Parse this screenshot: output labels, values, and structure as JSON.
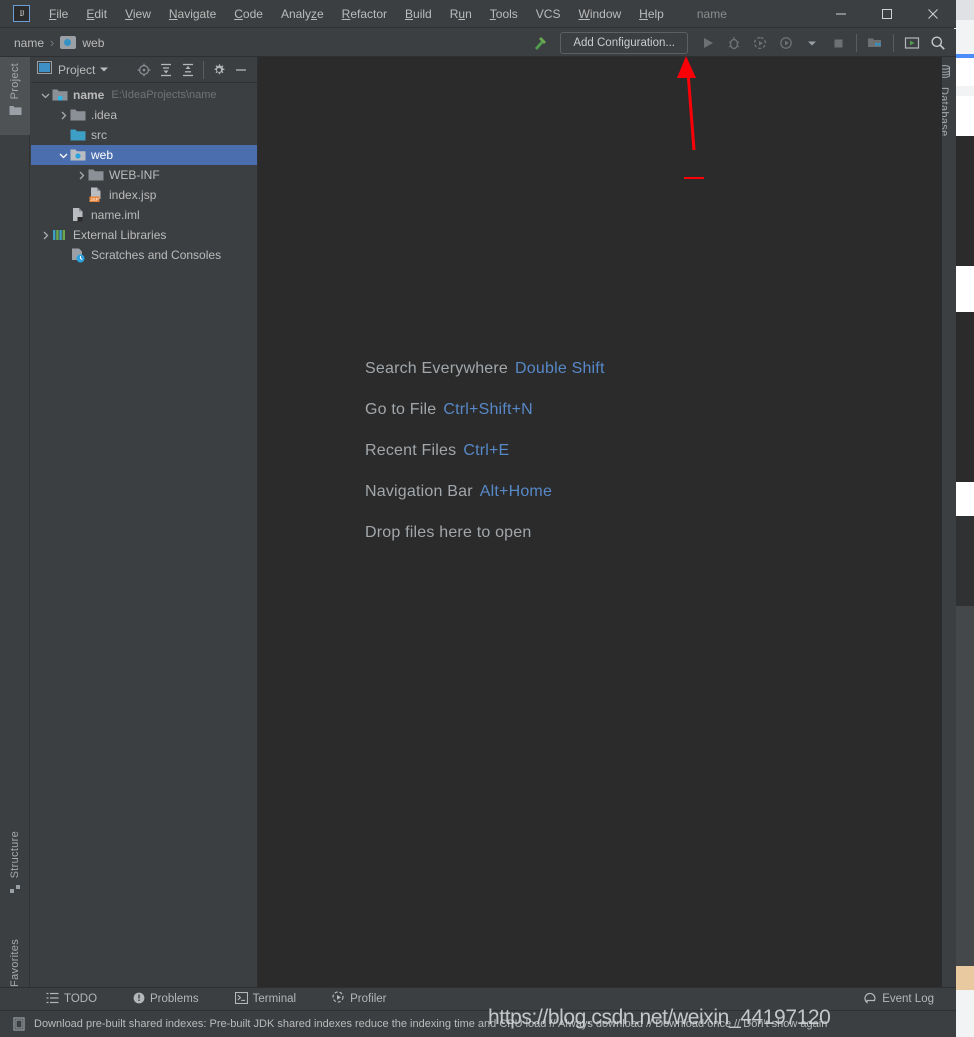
{
  "window": {
    "title": "name",
    "logo_text": "IJ",
    "controls": [
      {
        "name": "minimize",
        "glyph": "minimize-icon"
      },
      {
        "name": "maximize",
        "glyph": "maximize-icon"
      },
      {
        "name": "close",
        "glyph": "close-icon"
      }
    ]
  },
  "menubar": {
    "items": [
      {
        "label": "File",
        "mnemonic": "F"
      },
      {
        "label": "Edit",
        "mnemonic": "E"
      },
      {
        "label": "View",
        "mnemonic": "V"
      },
      {
        "label": "Navigate",
        "mnemonic": "N"
      },
      {
        "label": "Code",
        "mnemonic": "C"
      },
      {
        "label": "Analyze",
        "mnemonic": "y"
      },
      {
        "label": "Refactor",
        "mnemonic": "R"
      },
      {
        "label": "Build",
        "mnemonic": "B"
      },
      {
        "label": "Run",
        "mnemonic": "u"
      },
      {
        "label": "Tools",
        "mnemonic": "T"
      },
      {
        "label": "VCS",
        "mnemonic": ""
      },
      {
        "label": "Window",
        "mnemonic": "W"
      },
      {
        "label": "Help",
        "mnemonic": "H"
      }
    ]
  },
  "navbar": {
    "breadcrumbs": [
      "name",
      "web"
    ],
    "separator": "›",
    "run_config_button": "Add Configuration...",
    "icons": [
      "build-hammer-icon",
      "run-icon",
      "debug-icon",
      "run-with-coverage-icon",
      "profile-icon",
      "dropdown-arrow-icon",
      "stop-icon",
      "project-structure-icon",
      "update-icon",
      "search-icon"
    ]
  },
  "left_toolwindow_strip": {
    "top": [
      {
        "label": "Project",
        "icon": "folder-icon",
        "active": true
      }
    ],
    "bottom": [
      {
        "label": "Structure",
        "icon": "structure-icon",
        "active": false
      },
      {
        "label": "Favorites",
        "icon": "star-icon",
        "active": false
      }
    ]
  },
  "right_toolwindow_strip": {
    "items": [
      {
        "label": "Database",
        "icon": "database-icon",
        "active": false
      }
    ]
  },
  "project_panel": {
    "title": "Project",
    "header_icons": [
      "chevron-down-icon",
      "select-opened-file-icon",
      "expand-all-icon",
      "collapse-all-icon",
      "gear-icon",
      "hide-icon"
    ],
    "tree": [
      {
        "label": "name",
        "path": "E:\\IdeaProjects\\name",
        "icon": "module-folder-icon",
        "indent": 0,
        "arrow": "down",
        "selected": false,
        "bold": true
      },
      {
        "label": ".idea",
        "path": "",
        "icon": "folder-icon",
        "indent": 1,
        "arrow": "right",
        "selected": false,
        "bold": false
      },
      {
        "label": "src",
        "path": "",
        "icon": "source-folder-icon",
        "indent": 1,
        "arrow": "none",
        "selected": false,
        "bold": false
      },
      {
        "label": "web",
        "path": "",
        "icon": "web-folder-icon",
        "indent": 1,
        "arrow": "down",
        "selected": true,
        "bold": false
      },
      {
        "label": "WEB-INF",
        "path": "",
        "icon": "folder-icon",
        "indent": 2,
        "arrow": "right",
        "selected": false,
        "bold": false
      },
      {
        "label": "index.jsp",
        "path": "",
        "icon": "jsp-file-icon",
        "indent": 2,
        "arrow": "none",
        "selected": false,
        "bold": false
      },
      {
        "label": "name.iml",
        "path": "",
        "icon": "iml-file-icon",
        "indent": 1,
        "arrow": "none",
        "selected": false,
        "bold": false
      },
      {
        "label": "External Libraries",
        "path": "",
        "icon": "libraries-icon",
        "indent": 0,
        "arrow": "right",
        "selected": false,
        "bold": false
      },
      {
        "label": "Scratches and Consoles",
        "path": "",
        "icon": "scratches-icon",
        "indent": 0,
        "arrow": "none",
        "selected": false,
        "bold": false
      }
    ]
  },
  "editor": {
    "hints": [
      {
        "action": "Search Everywhere",
        "shortcut": "Double Shift"
      },
      {
        "action": "Go to File",
        "shortcut": "Ctrl+Shift+N"
      },
      {
        "action": "Recent Files",
        "shortcut": "Ctrl+E"
      },
      {
        "action": "Navigation Bar",
        "shortcut": "Alt+Home"
      },
      {
        "action": "Drop files here to open",
        "shortcut": ""
      }
    ]
  },
  "bottom_toolwindows": {
    "left": [
      {
        "label": "TODO",
        "icon": "todo-list-icon"
      },
      {
        "label": "Problems",
        "icon": "problems-icon"
      },
      {
        "label": "Terminal",
        "icon": "terminal-icon"
      },
      {
        "label": "Profiler",
        "icon": "profiler-icon"
      }
    ],
    "right": [
      {
        "label": "Event Log",
        "icon": "event-log-icon"
      }
    ]
  },
  "statusbar": {
    "icon": "notification-icon",
    "message": "Download pre-built shared indexes: Pre-built JDK shared indexes reduce the indexing time and CPU load // Always download // Download once // Don't show again"
  },
  "annotation": {
    "type": "red-arrow",
    "color": "#fb0007",
    "points_to": "Add Configuration..."
  },
  "watermark": {
    "text": "https://blog.csdn.net/weixin_44197120"
  },
  "colors": {
    "window_chrome": "#3c3f41",
    "editor_bg": "#2b2b2b",
    "selection": "#4b6eaf",
    "text": "#bbbbbb",
    "shortcut_blue": "#5789c8",
    "accent_red": "#fb0007"
  }
}
